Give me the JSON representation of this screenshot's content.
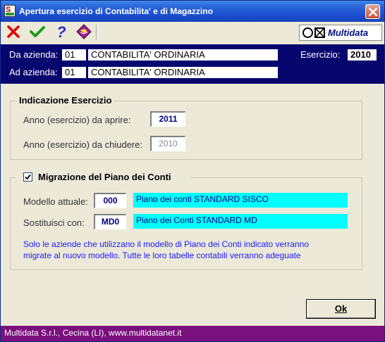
{
  "window": {
    "title": "Apertura esercizio di Contabilita' e di Magazzino",
    "app_icon_letter": "S"
  },
  "toolbar": {
    "buttons": [
      {
        "icon": "red-x-icon",
        "color": "#e00000"
      },
      {
        "icon": "green-check-icon",
        "color": "#1a9a1a"
      },
      {
        "icon": "help-question-icon",
        "color": "#2030c0"
      },
      {
        "icon": "book-diamond-icon",
        "color": "#a02090"
      }
    ],
    "logo_text": "Multidata"
  },
  "header": {
    "da_label": "Da azienda:",
    "da_code": "01",
    "da_name": "CONTABILITA' ORDINARIA",
    "ad_label": "Ad azienda:",
    "ad_code": "01",
    "ad_name": "CONTABILITA' ORDINARIA",
    "esercizio_label": "Esercizio:",
    "esercizio_value": "2010"
  },
  "indicazione": {
    "title": "Indicazione Esercizio",
    "aprire_label": "Anno (esercizio) da aprire:",
    "aprire_value": "2011",
    "chiudere_label": "Anno (esercizio) da chiudere:",
    "chiudere_value": "2010"
  },
  "migrazione": {
    "title": "Migrazione del Piano dei Conti",
    "checked": true,
    "attuale_label": "Modello attuale:",
    "attuale_code": "000",
    "attuale_desc": "Piano dei conti STANDARD SISCO",
    "sostituisci_label": "Sostituisci con:",
    "sostituisci_code": "MD0",
    "sostituisci_desc": "Piano dei Conti STANDARD MD",
    "note_line1": "Solo le aziende che utilizzano il modello di Piano dei Conti indicato verranno",
    "note_line2": "migrate al nuovo modello. Tutte le loro tabelle contabili verranno adeguate"
  },
  "ok_button": {
    "label": "Ok"
  },
  "footer": {
    "text": "Multidata S.r.l., Cecina (LI), www.multidatanet.it"
  },
  "colors": {
    "header_band": "#06066e",
    "footer": "#7a0f7e",
    "cyan_field": "#00ffff",
    "note_text": "#1a1aff"
  }
}
